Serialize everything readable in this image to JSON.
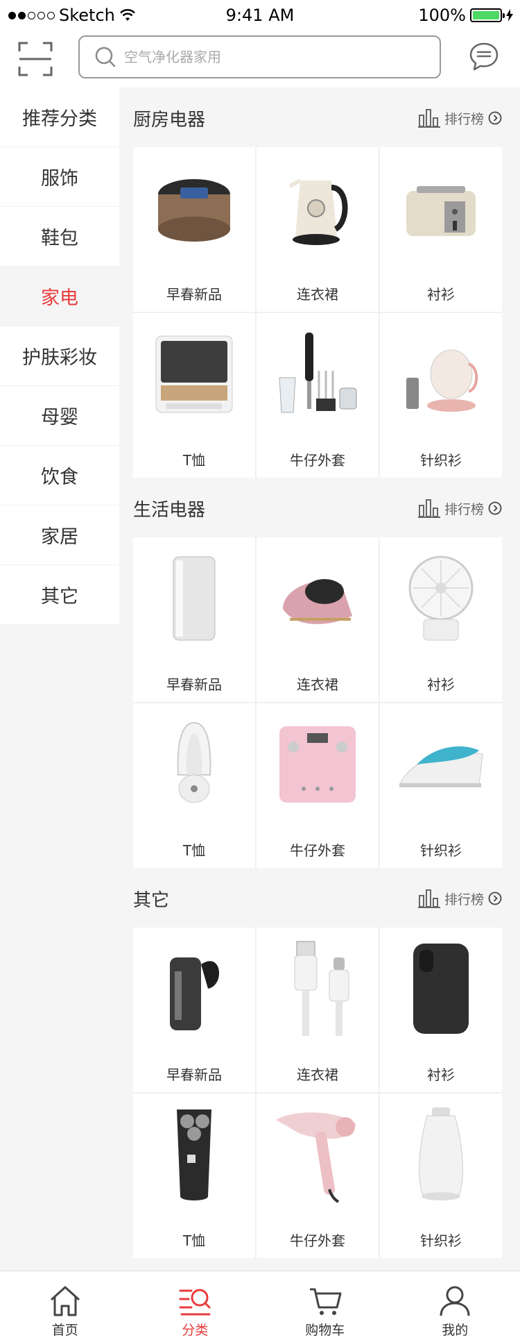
{
  "status_bar": {
    "carrier": "Sketch",
    "time": "9:41 AM",
    "battery": "100%"
  },
  "search": {
    "placeholder": "空气净化器家用"
  },
  "sidebar": {
    "items": [
      {
        "label": "推荐分类"
      },
      {
        "label": "服饰"
      },
      {
        "label": "鞋包"
      },
      {
        "label": "家电"
      },
      {
        "label": "护肤彩妆"
      },
      {
        "label": "母婴"
      },
      {
        "label": "饮食"
      },
      {
        "label": "家居"
      },
      {
        "label": "其它"
      }
    ],
    "active_index": 3
  },
  "sections": [
    {
      "title": "厨房电器",
      "rank_label": "排行榜",
      "items": [
        {
          "label": "早春新品",
          "icon": "rice-cooker-icon"
        },
        {
          "label": "连衣裙",
          "icon": "kettle-icon"
        },
        {
          "label": "衬衫",
          "icon": "toaster-icon"
        },
        {
          "label": "T恤",
          "icon": "dishwasher-icon"
        },
        {
          "label": "牛仔外套",
          "icon": "hand-blender-icon"
        },
        {
          "label": "针织衫",
          "icon": "health-pot-icon"
        }
      ]
    },
    {
      "title": "生活电器",
      "rank_label": "排行榜",
      "items": [
        {
          "label": "早春新品",
          "icon": "dryer-cabinet-icon"
        },
        {
          "label": "连衣裙",
          "icon": "mite-vacuum-icon"
        },
        {
          "label": "衬衫",
          "icon": "desk-fan-icon"
        },
        {
          "label": "T恤",
          "icon": "night-lamp-icon"
        },
        {
          "label": "牛仔外套",
          "icon": "body-scale-icon"
        },
        {
          "label": "针织衫",
          "icon": "steam-iron-icon"
        }
      ]
    },
    {
      "title": "其它",
      "rank_label": "排行榜",
      "items": [
        {
          "label": "早春新品",
          "icon": "bluetooth-headset-icon"
        },
        {
          "label": "连衣裙",
          "icon": "usb-cable-icon"
        },
        {
          "label": "衬衫",
          "icon": "phone-case-icon"
        },
        {
          "label": "T恤",
          "icon": "shaver-icon"
        },
        {
          "label": "牛仔外套",
          "icon": "hair-dryer-icon"
        },
        {
          "label": "针织衫",
          "icon": "humidifier-icon"
        }
      ]
    }
  ],
  "tabbar": {
    "items": [
      {
        "label": "首页",
        "icon": "home-icon"
      },
      {
        "label": "分类",
        "icon": "category-search-icon"
      },
      {
        "label": "购物车",
        "icon": "cart-icon"
      },
      {
        "label": "我的",
        "icon": "user-icon"
      }
    ],
    "active_index": 1
  },
  "colors": {
    "accent": "#e93b3d",
    "background": "#f5f5f5",
    "battery": "#4cd964"
  }
}
